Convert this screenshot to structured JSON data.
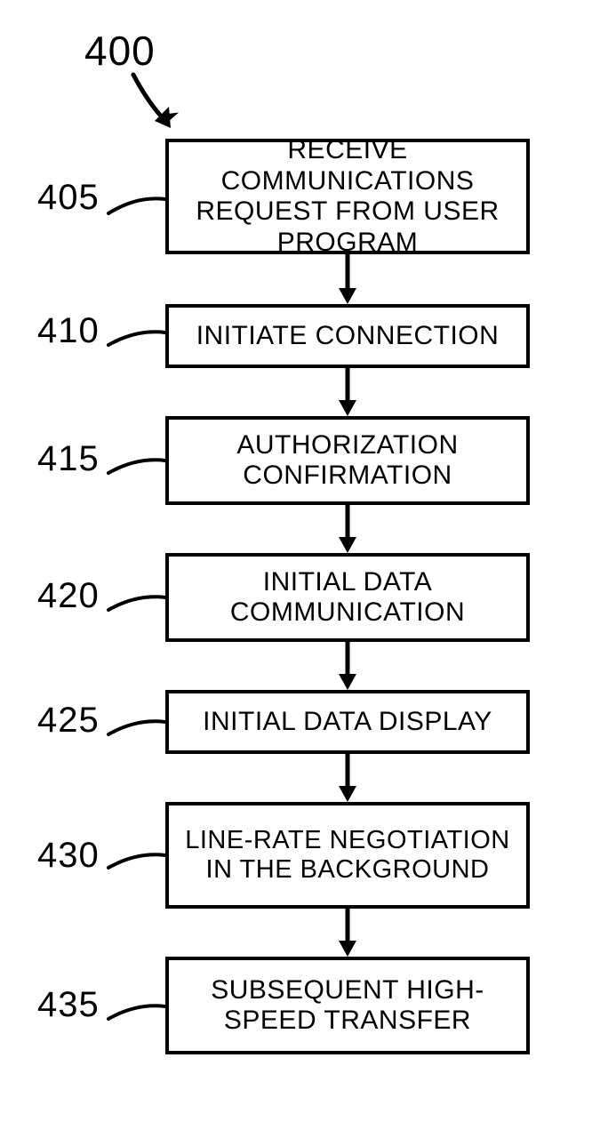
{
  "diagram": {
    "number": "400",
    "steps": [
      {
        "ref": "405",
        "text": "RECEIVE COMMUNICATIONS REQUEST FROM USER PROGRAM"
      },
      {
        "ref": "410",
        "text": "INITIATE CONNECTION"
      },
      {
        "ref": "415",
        "text": "AUTHORIZATION CONFIRMATION"
      },
      {
        "ref": "420",
        "text": "INITIAL DATA COMMUNICATION"
      },
      {
        "ref": "425",
        "text": "INITIAL DATA DISPLAY"
      },
      {
        "ref": "430",
        "text": "LINE-RATE NEGOTIATION IN THE BACKGROUND"
      },
      {
        "ref": "435",
        "text": "SUBSEQUENT HIGH-SPEED TRANSFER"
      }
    ]
  }
}
